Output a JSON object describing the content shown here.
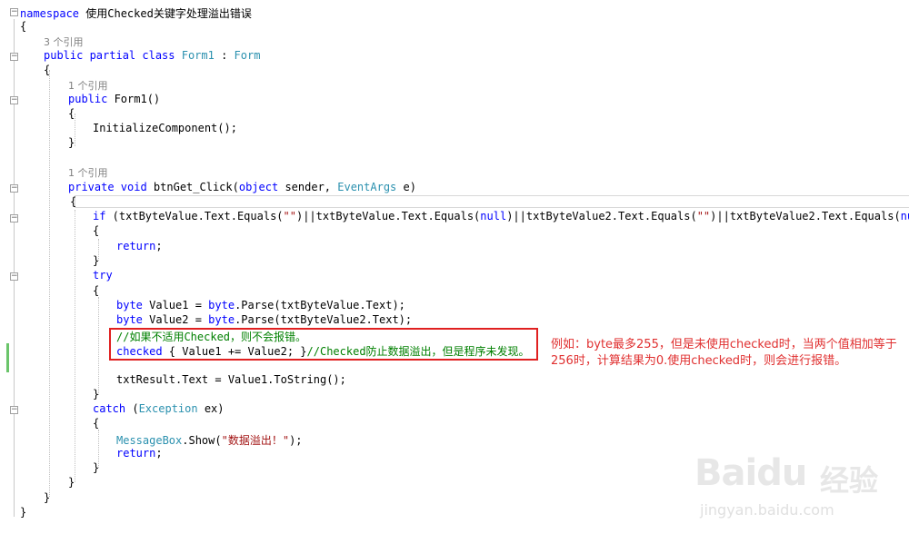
{
  "code": {
    "l0": {
      "kw": "namespace",
      "rest": " 使用Checked关键字处理溢出错误"
    },
    "l1": "{",
    "l2_ref": "3 个引用",
    "l3": {
      "kw1": "public partial class",
      "name": " Form1",
      "sep": " : ",
      "base": "Form"
    },
    "l4": "{",
    "l5_ref": "1 个引用",
    "l6": {
      "kw": "public",
      "rest": " Form1()"
    },
    "l7": "{",
    "l8": "InitializeComponent();",
    "l9": "}",
    "l10_ref": "1 个引用",
    "l11": {
      "kw1": "private void",
      "name": " btnGet_Click(",
      "kw2": "object",
      "p1": " sender, ",
      "ty": "EventArgs",
      "p2": " e)"
    },
    "l12": "{",
    "l13": {
      "kw": "if",
      "a": " (txtByteValue.Text.Equals(",
      "s1": "\"\"",
      "b": ")||txtByteValue.Text.Equals(",
      "n1": "null",
      "c": ")||txtByteValue2.Text.Equals(",
      "s2": "\"\"",
      "d": ")||txtByteValue2.Text.Equals(",
      "n2": "null",
      "e": "))"
    },
    "l14": "{",
    "l15": {
      "kw": "return",
      "rest": ";"
    },
    "l16": "}",
    "l17": "try",
    "l18": "{",
    "l19": {
      "kw": "byte",
      "a": " Value1 = ",
      "kw2": "byte",
      "b": ".Parse(txtByteValue.Text);"
    },
    "l20": {
      "kw": "byte",
      "a": " Value2 = ",
      "kw2": "byte",
      "b": ".Parse(txtByteValue2.Text);"
    },
    "l21": "//如果不适用Checked，则不会报错。",
    "l22": {
      "kw": "checked",
      "a": " { Value1 += Value2; }",
      "cm": "//Checked防止数据溢出，但是程序未发现。"
    },
    "l23": "txtResult.Text = Value1.ToString();",
    "l24": "}",
    "l25": {
      "kw": "catch",
      "a": " (",
      "ty": "Exception",
      "b": " ex)"
    },
    "l26": "{",
    "l27": {
      "ty": "MessageBox",
      "a": ".Show(",
      "s": "\"数据溢出！\"",
      "b": ");"
    },
    "l28": {
      "kw": "return",
      "rest": ";"
    },
    "l29": "}",
    "l30": "}",
    "l31": "}",
    "l32": "}"
  },
  "annotation": "例如：byte最多255，但是未使用checked时，当两个值相加等于256时，计算结果为0.使用checked时，则会进行报错。",
  "watermark": {
    "logo": "Baidu",
    "cn": "经验",
    "url": "jingyan.baidu.com"
  },
  "fold_symbols": {
    "minus": "−"
  }
}
